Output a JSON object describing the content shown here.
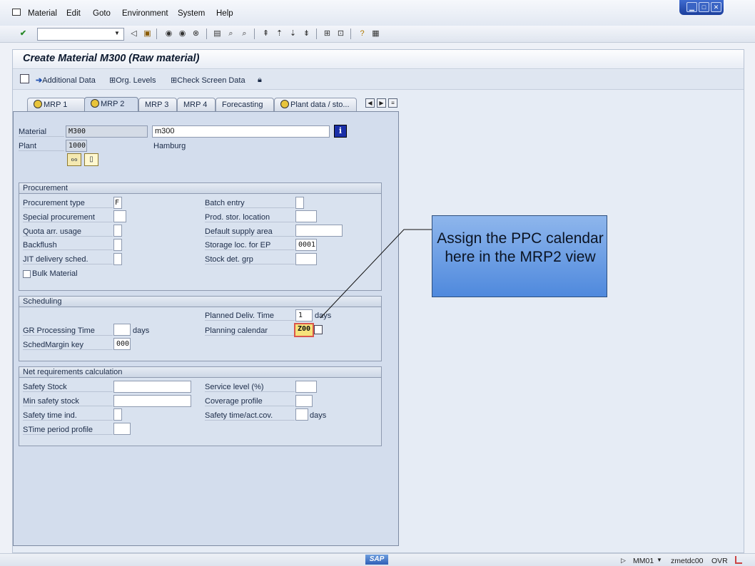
{
  "menubar": {
    "items": [
      "Material",
      "Edit",
      "Goto",
      "Environment",
      "System",
      "Help"
    ]
  },
  "header": {
    "title": "Create Material M300 (Raw material)"
  },
  "app_toolbar": {
    "additional_data": "Additional Data",
    "org_levels": "Org. Levels",
    "check_screen_data": "Check Screen Data"
  },
  "tabs": [
    "MRP 1",
    "MRP 2",
    "MRP 3",
    "MRP 4",
    "Forecasting",
    "Plant data / sto..."
  ],
  "active_tab": "MRP 2",
  "header_fields": {
    "material_label": "Material",
    "material_value": "M300",
    "material_desc": "m300",
    "plant_label": "Plant",
    "plant_value": "1000",
    "plant_desc": "Hamburg"
  },
  "procurement": {
    "title": "Procurement",
    "procurement_type_label": "Procurement type",
    "procurement_type_value": "F",
    "special_procurement_label": "Special procurement",
    "quota_arr_label": "Quota arr. usage",
    "backflush_label": "Backflush",
    "jit_label": "JIT delivery sched.",
    "bulk_material_label": "Bulk Material",
    "batch_entry_label": "Batch entry",
    "prod_stor_label": "Prod. stor. location",
    "default_supply_label": "Default supply area",
    "storage_loc_ep_label": "Storage loc. for EP",
    "storage_loc_ep_value": "0001",
    "stock_det_label": "Stock det. grp"
  },
  "scheduling": {
    "title": "Scheduling",
    "planned_deliv_label": "Planned Deliv. Time",
    "planned_deliv_value": "1",
    "planned_deliv_unit": "days",
    "gr_processing_label": "GR Processing Time",
    "gr_processing_unit": "days",
    "planning_calendar_label": "Planning calendar",
    "planning_calendar_value": "Z00",
    "schedmargin_label": "SchedMargin key",
    "schedmargin_value": "000"
  },
  "net_requirements": {
    "title": "Net requirements calculation",
    "safety_stock_label": "Safety Stock",
    "min_safety_label": "Min safety stock",
    "safety_time_ind_label": "Safety time ind.",
    "stime_period_label": "STime period profile",
    "service_level_label": "Service level (%)",
    "coverage_profile_label": "Coverage profile",
    "safety_time_cov_label": "Safety time/act.cov.",
    "safety_time_cov_unit": "days"
  },
  "callout": {
    "text": "Assign the PPC calendar here in the MRP2 view"
  },
  "statusbar": {
    "logo": "SAP",
    "transaction": "MM01",
    "server": "zmetdc00",
    "mode": "OVR"
  },
  "colors": {
    "callout_fill": "#6fa0e4",
    "highlight_field": "#f6e27a",
    "highlight_border": "#d9564d"
  }
}
